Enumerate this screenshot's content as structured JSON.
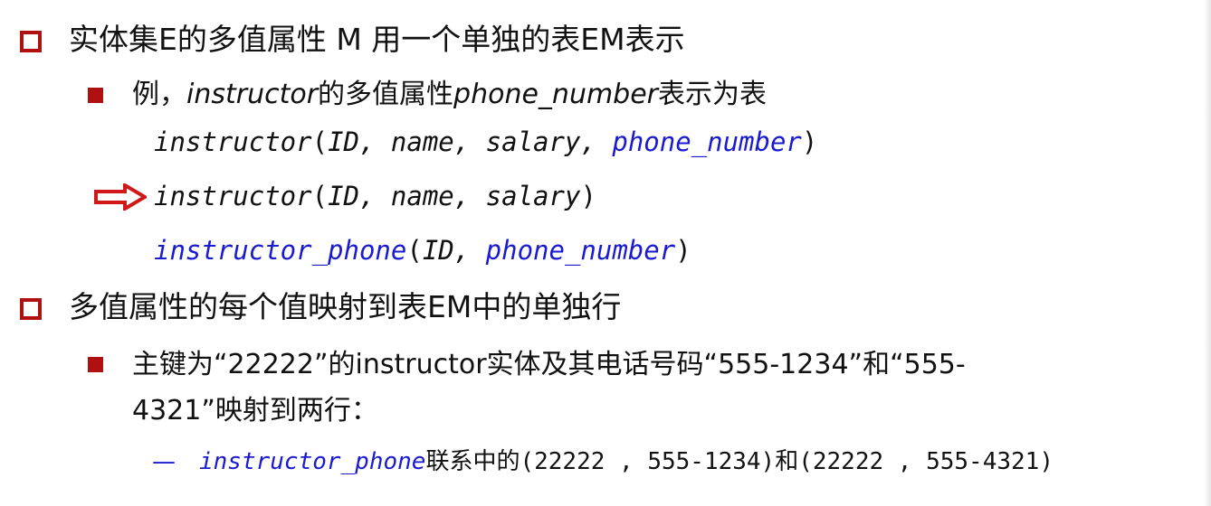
{
  "heading1": "实体集E的多值属性 M 用一个单独的表EM表示",
  "bullet1": {
    "prefix": "例，",
    "entity": "instructor",
    "mid": "的多值属性",
    "attr": "phone_number",
    "suffix": "表示为表"
  },
  "schema_original": {
    "name": "instructor",
    "open": "(",
    "attrs_plain": "ID, name, salary, ",
    "attr_multi": "phone_number",
    "close": ")"
  },
  "schema_result1": {
    "name": "instructor",
    "open": "(",
    "attrs": "ID, name, salary",
    "close": ")"
  },
  "schema_result2": {
    "name": "instructor_phone",
    "open": "(",
    "attr_id": "ID, ",
    "attr_phone": "phone_number",
    "close": ")"
  },
  "heading2": "多值属性的每个值映射到表EM中的单独行",
  "bullet2": {
    "line1": "主键为“22222”的instructor实体及其电话号码“555-1234”和“555-",
    "line2": "4321”映射到两行："
  },
  "subitem": {
    "dash": "—",
    "relation": "instructor_phone",
    "text": "联系中的(22222 , 555-1234)和(22222 , 555-4321)"
  },
  "colors": {
    "bullet_red": "#b01010",
    "highlight_blue": "#1a1ad0",
    "arrow_red": "#d01818"
  }
}
